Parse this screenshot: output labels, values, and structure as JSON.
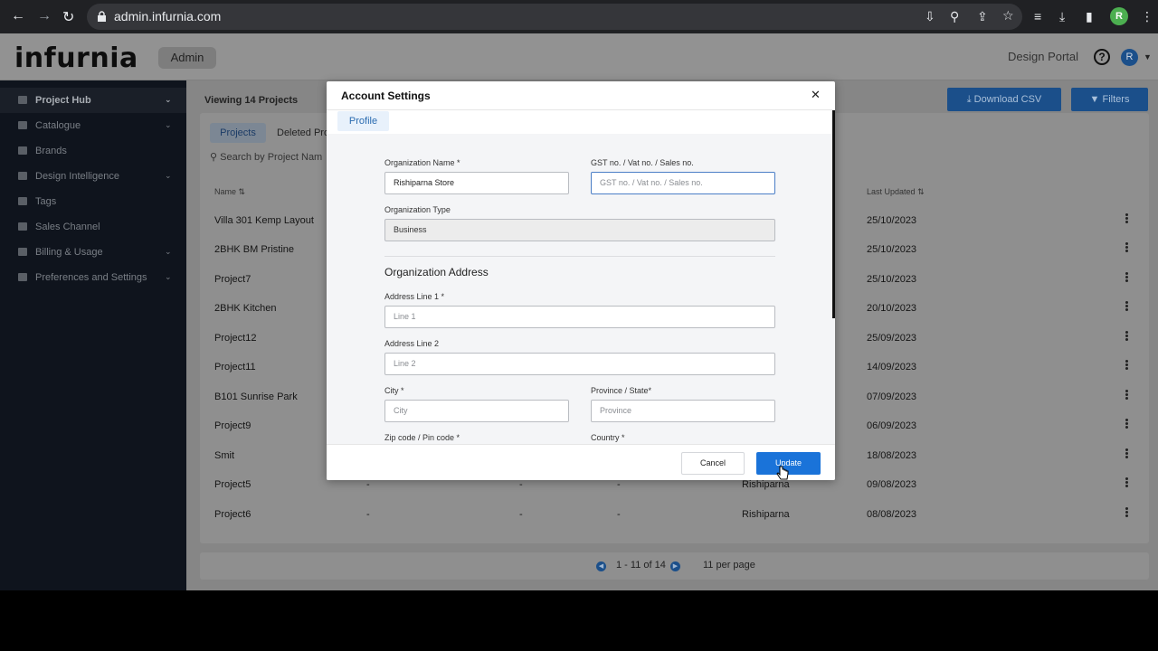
{
  "browser": {
    "url": "admin.infurnia.com",
    "profile_initial": "R"
  },
  "app": {
    "logo": "infurnia",
    "badge": "Admin",
    "design_portal": "Design Portal",
    "help_symbol": "?",
    "user_initial": "R"
  },
  "sidebar": {
    "items": [
      {
        "label": "Project Hub",
        "icon": "folder-icon",
        "chevron": true,
        "active": true
      },
      {
        "label": "Catalogue",
        "icon": "catalogue-icon",
        "chevron": true
      },
      {
        "label": "Brands",
        "icon": "brand-icon",
        "chevron": false
      },
      {
        "label": "Design Intelligence",
        "icon": "network-icon",
        "chevron": true
      },
      {
        "label": "Tags",
        "icon": "tag-icon",
        "chevron": false
      },
      {
        "label": "Sales Channel",
        "icon": "channel-icon",
        "chevron": false
      },
      {
        "label": "Billing & Usage",
        "icon": "billing-icon",
        "chevron": true
      },
      {
        "label": "Preferences and Settings",
        "icon": "settings-icon",
        "chevron": true
      }
    ]
  },
  "main": {
    "viewing": "Viewing 14 Projects",
    "download_csv": "Download CSV",
    "filters": "Filters",
    "tabs": [
      "Projects",
      "Deleted Pro"
    ],
    "search_placeholder": "Search by Project Nam",
    "columns": {
      "name": "Name",
      "last_updated": "Last Updated"
    },
    "rows": [
      {
        "name": "Villa 301 Kemp Layout",
        "c2": "",
        "c3": "",
        "c4": "",
        "owner": "",
        "date": "25/10/2023"
      },
      {
        "name": "2BHK BM Pristine",
        "c2": "",
        "c3": "",
        "c4": "",
        "owner": "",
        "date": "25/10/2023"
      },
      {
        "name": "Project7",
        "c2": "",
        "c3": "",
        "c4": "",
        "owner": "",
        "date": "25/10/2023"
      },
      {
        "name": "2BHK Kitchen",
        "c2": "",
        "c3": "",
        "c4": "",
        "owner": "",
        "date": "20/10/2023"
      },
      {
        "name": "Project12",
        "c2": "",
        "c3": "",
        "c4": "",
        "owner": "",
        "date": "25/09/2023"
      },
      {
        "name": "Project11",
        "c2": "",
        "c3": "",
        "c4": "",
        "owner": "",
        "date": "14/09/2023"
      },
      {
        "name": "B101 Sunrise Park",
        "c2": "",
        "c3": "",
        "c4": "",
        "owner": "",
        "date": "07/09/2023"
      },
      {
        "name": "Project9",
        "c2": "",
        "c3": "",
        "c4": "",
        "owner": "",
        "date": "06/09/2023"
      },
      {
        "name": "Smit",
        "c2": "",
        "c3": "",
        "c4": "",
        "owner": "",
        "date": "18/08/2023"
      },
      {
        "name": "Project5",
        "c2": "-",
        "c3": "-",
        "c4": "-",
        "owner": "Rishiparna",
        "date": "09/08/2023"
      },
      {
        "name": "Project6",
        "c2": "-",
        "c3": "-",
        "c4": "-",
        "owner": "Rishiparna",
        "date": "08/08/2023"
      }
    ],
    "pagination": {
      "range": "1 - 11 of 14",
      "per_page": "11 per page"
    }
  },
  "modal": {
    "title": "Account Settings",
    "close": "✕",
    "tab": "Profile",
    "org_name_label": "Organization Name *",
    "org_name_value": "Rishiparna Store",
    "gst_label": "GST no. / Vat no. / Sales no.",
    "gst_placeholder": "GST no. / Vat no. / Sales no.",
    "org_type_label": "Organization Type",
    "org_type_value": "Business",
    "address_header": "Organization Address",
    "addr1_label": "Address Line 1 *",
    "addr1_placeholder": "Line 1",
    "addr2_label": "Address Line 2",
    "addr2_placeholder": "Line 2",
    "city_label": "City *",
    "city_placeholder": "City",
    "province_label": "Province / State*",
    "province_placeholder": "Province",
    "zip_label": "Zip code / Pin code *",
    "country_label": "Country *",
    "cancel": "Cancel",
    "update": "Update"
  }
}
